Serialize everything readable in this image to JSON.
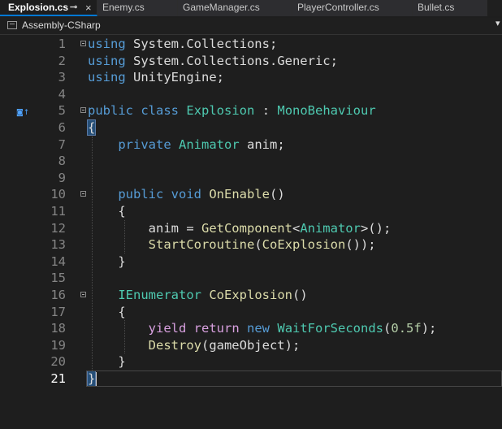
{
  "tabs": [
    {
      "label": "Explosion.cs",
      "active": true
    },
    {
      "label": "Enemy.cs"
    },
    {
      "label": "GameManager.cs"
    },
    {
      "label": "PlayerController.cs"
    },
    {
      "label": "Bullet.cs"
    }
  ],
  "tab_icons": {
    "pin": "⊸",
    "close": "×"
  },
  "navbar": {
    "project": "Assembly-CSharp",
    "dropdown": "▾"
  },
  "gutter_icon": "◙↑",
  "code_lines": [
    {
      "n": "1",
      "segments": [
        [
          "kw",
          "using"
        ],
        [
          "plain",
          " System.Collections;"
        ]
      ]
    },
    {
      "n": "2",
      "segments": [
        [
          "kw",
          "using"
        ],
        [
          "plain",
          " System.Collections.Generic;"
        ]
      ]
    },
    {
      "n": "3",
      "segments": [
        [
          "kw",
          "using"
        ],
        [
          "plain",
          " UnityEngine;"
        ]
      ]
    },
    {
      "n": "4",
      "segments": []
    },
    {
      "n": "5",
      "segments": [
        [
          "kw",
          "public"
        ],
        [
          "plain",
          " "
        ],
        [
          "kw",
          "class"
        ],
        [
          "plain",
          " "
        ],
        [
          "type",
          "Explosion"
        ],
        [
          "plain",
          " : "
        ],
        [
          "type",
          "MonoBehaviour"
        ]
      ]
    },
    {
      "n": "6",
      "segments": [
        [
          "brace",
          "{"
        ]
      ]
    },
    {
      "n": "7",
      "segments": [
        [
          "plain",
          "    "
        ],
        [
          "kw",
          "private"
        ],
        [
          "plain",
          " "
        ],
        [
          "type",
          "Animator"
        ],
        [
          "plain",
          " anim;"
        ]
      ]
    },
    {
      "n": "8",
      "segments": []
    },
    {
      "n": "9",
      "segments": []
    },
    {
      "n": "10",
      "segments": [
        [
          "plain",
          "    "
        ],
        [
          "kw",
          "public"
        ],
        [
          "plain",
          " "
        ],
        [
          "kw",
          "void"
        ],
        [
          "plain",
          " "
        ],
        [
          "method",
          "OnEnable"
        ],
        [
          "plain",
          "()"
        ]
      ]
    },
    {
      "n": "11",
      "segments": [
        [
          "plain",
          "    {"
        ]
      ]
    },
    {
      "n": "12",
      "segments": [
        [
          "plain",
          "        anim = "
        ],
        [
          "method",
          "GetComponent"
        ],
        [
          "plain",
          "<"
        ],
        [
          "type",
          "Animator"
        ],
        [
          "plain",
          ">();"
        ]
      ]
    },
    {
      "n": "13",
      "segments": [
        [
          "plain",
          "        "
        ],
        [
          "method",
          "StartCoroutine"
        ],
        [
          "plain",
          "("
        ],
        [
          "method",
          "CoExplosion"
        ],
        [
          "plain",
          "());"
        ]
      ]
    },
    {
      "n": "14",
      "segments": [
        [
          "plain",
          "    }"
        ]
      ]
    },
    {
      "n": "15",
      "segments": []
    },
    {
      "n": "16",
      "segments": [
        [
          "plain",
          "    "
        ],
        [
          "type",
          "IEnumerator"
        ],
        [
          "plain",
          " "
        ],
        [
          "method",
          "CoExplosion"
        ],
        [
          "plain",
          "()"
        ]
      ]
    },
    {
      "n": "17",
      "segments": [
        [
          "plain",
          "    {"
        ]
      ]
    },
    {
      "n": "18",
      "segments": [
        [
          "plain",
          "        "
        ],
        [
          "kw2",
          "yield"
        ],
        [
          "plain",
          " "
        ],
        [
          "kw2",
          "return"
        ],
        [
          "plain",
          " "
        ],
        [
          "kw",
          "new"
        ],
        [
          "plain",
          " "
        ],
        [
          "type",
          "WaitForSeconds"
        ],
        [
          "plain",
          "("
        ],
        [
          "num",
          "0.5f"
        ],
        [
          "plain",
          ");"
        ]
      ]
    },
    {
      "n": "19",
      "segments": [
        [
          "plain",
          "        "
        ],
        [
          "method",
          "Destroy"
        ],
        [
          "plain",
          "(gameObject);"
        ]
      ]
    },
    {
      "n": "20",
      "segments": [
        [
          "plain",
          "    }"
        ]
      ]
    },
    {
      "n": "21",
      "segments": [
        [
          "brace",
          "}"
        ]
      ]
    }
  ]
}
